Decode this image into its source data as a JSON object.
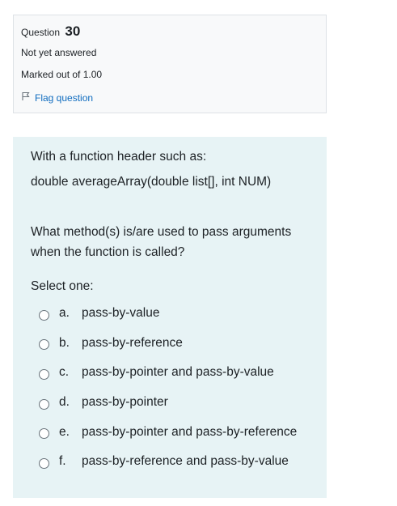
{
  "info": {
    "question_label": "Question",
    "question_number": "30",
    "state": "Not yet answered",
    "grade": "Marked out of 1.00",
    "flag_label": "Flag question"
  },
  "question": {
    "intro": "With a function header such as:",
    "code": "double averageArray(double list[], int NUM)",
    "text": "What method(s) is/are used to pass arguments when the function is called?",
    "prompt": "Select one:",
    "options": [
      {
        "letter": "a.",
        "text": "pass-by-value"
      },
      {
        "letter": "b.",
        "text": "pass-by-reference"
      },
      {
        "letter": "c.",
        "text": "pass-by-pointer and pass-by-value"
      },
      {
        "letter": "d.",
        "text": "pass-by-pointer"
      },
      {
        "letter": "e.",
        "text": "pass-by-pointer and pass-by-reference"
      },
      {
        "letter": "f.",
        "text": "pass-by-reference and pass-by-value"
      }
    ]
  },
  "icons": {
    "flag": "flag-outline-icon"
  },
  "colors": {
    "link": "#0f6cbf",
    "formulation_bg": "#e7f3f5",
    "info_bg": "#f8f9fa"
  }
}
